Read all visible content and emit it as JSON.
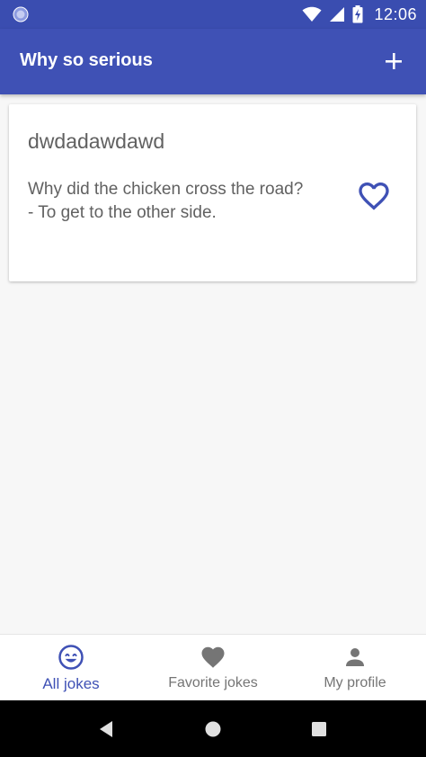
{
  "status_bar": {
    "time": "12:06",
    "icons": [
      "sync-circle-icon",
      "wifi-icon",
      "cell-signal-icon",
      "battery-charging-icon"
    ]
  },
  "app_bar": {
    "title": "Why so serious",
    "add_icon": "plus-icon"
  },
  "jokes": [
    {
      "title": "dwdadawdawd",
      "text": "Why did the chicken cross the road?\n- To get to the other side.",
      "favorite_icon": "heart-outline-icon"
    }
  ],
  "bottom_nav": {
    "items": [
      {
        "label": "All jokes",
        "icon": "smiley-icon",
        "active": true
      },
      {
        "label": "Favorite jokes",
        "icon": "heart-icon",
        "active": false
      },
      {
        "label": "My profile",
        "icon": "person-icon",
        "active": false
      }
    ]
  },
  "colors": {
    "primary": "#3f51b5",
    "status_bar": "#3a4db0",
    "text_secondary": "#616161",
    "inactive_nav": "#757575"
  },
  "system_nav": {
    "icons": [
      "back-icon",
      "home-icon",
      "recents-icon"
    ]
  }
}
